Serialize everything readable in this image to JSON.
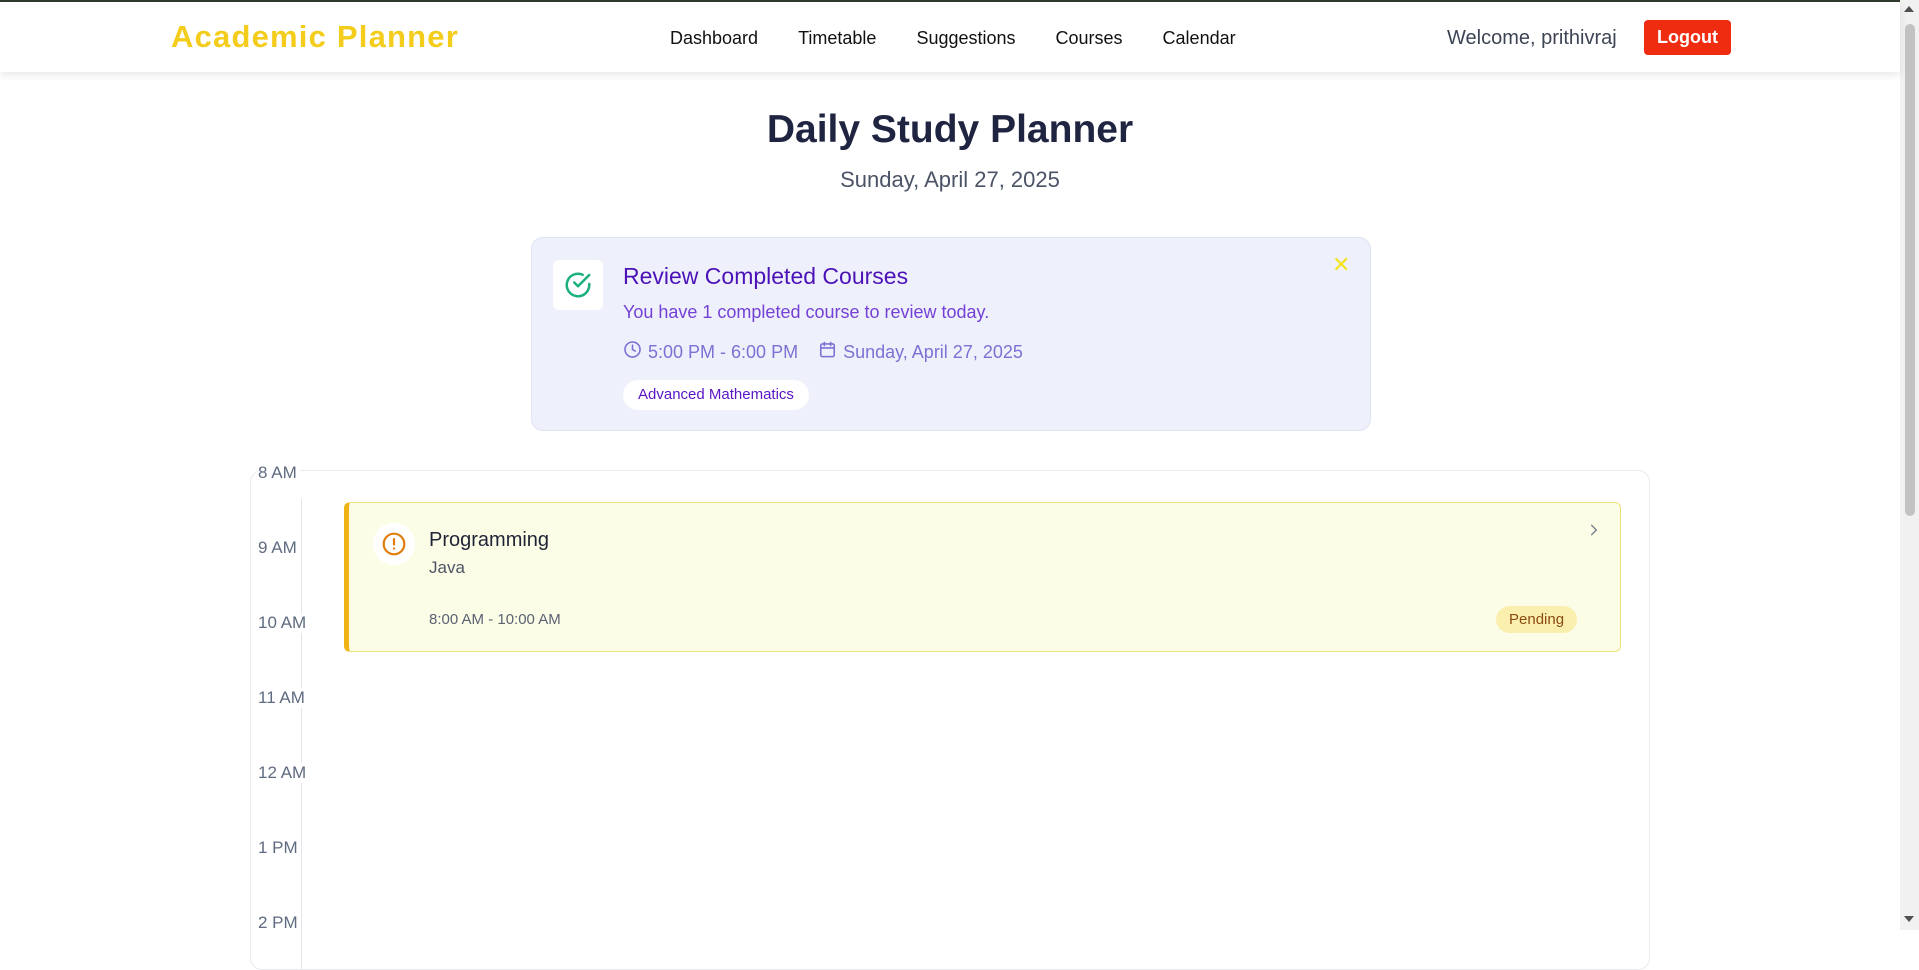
{
  "app": {
    "brand": "Academic Planner"
  },
  "nav": {
    "links": [
      {
        "label": "Dashboard"
      },
      {
        "label": "Timetable"
      },
      {
        "label": "Suggestions"
      },
      {
        "label": "Courses"
      },
      {
        "label": "Calendar"
      }
    ],
    "welcome": "Welcome, prithivraj",
    "logout_label": "Logout"
  },
  "page": {
    "title": "Daily Study Planner",
    "date": "Sunday, April 27, 2025"
  },
  "review": {
    "icon": "check-circle-icon",
    "title": "Review Completed Courses",
    "text": "You have 1 completed course to review today.",
    "time": "5:00 PM - 6:00 PM",
    "date": "Sunday, April 27, 2025",
    "course": "Advanced Mathematics",
    "close_icon": "close-icon",
    "close_glyph": "✕"
  },
  "schedule": {
    "hours": [
      "8 AM",
      "9 AM",
      "10 AM",
      "11 AM",
      "12 AM",
      "1 PM",
      "2 PM"
    ],
    "events": [
      {
        "title": "Programming",
        "subtitle": "Java",
        "time": "8:00 AM - 10:00 AM",
        "status": "Pending",
        "icon": "alert-circle-icon"
      }
    ]
  },
  "colors": {
    "brand": "#f3cc1c",
    "logout": "#ef2b10",
    "review_title": "#4c12b8",
    "event_accent": "#efb315"
  }
}
